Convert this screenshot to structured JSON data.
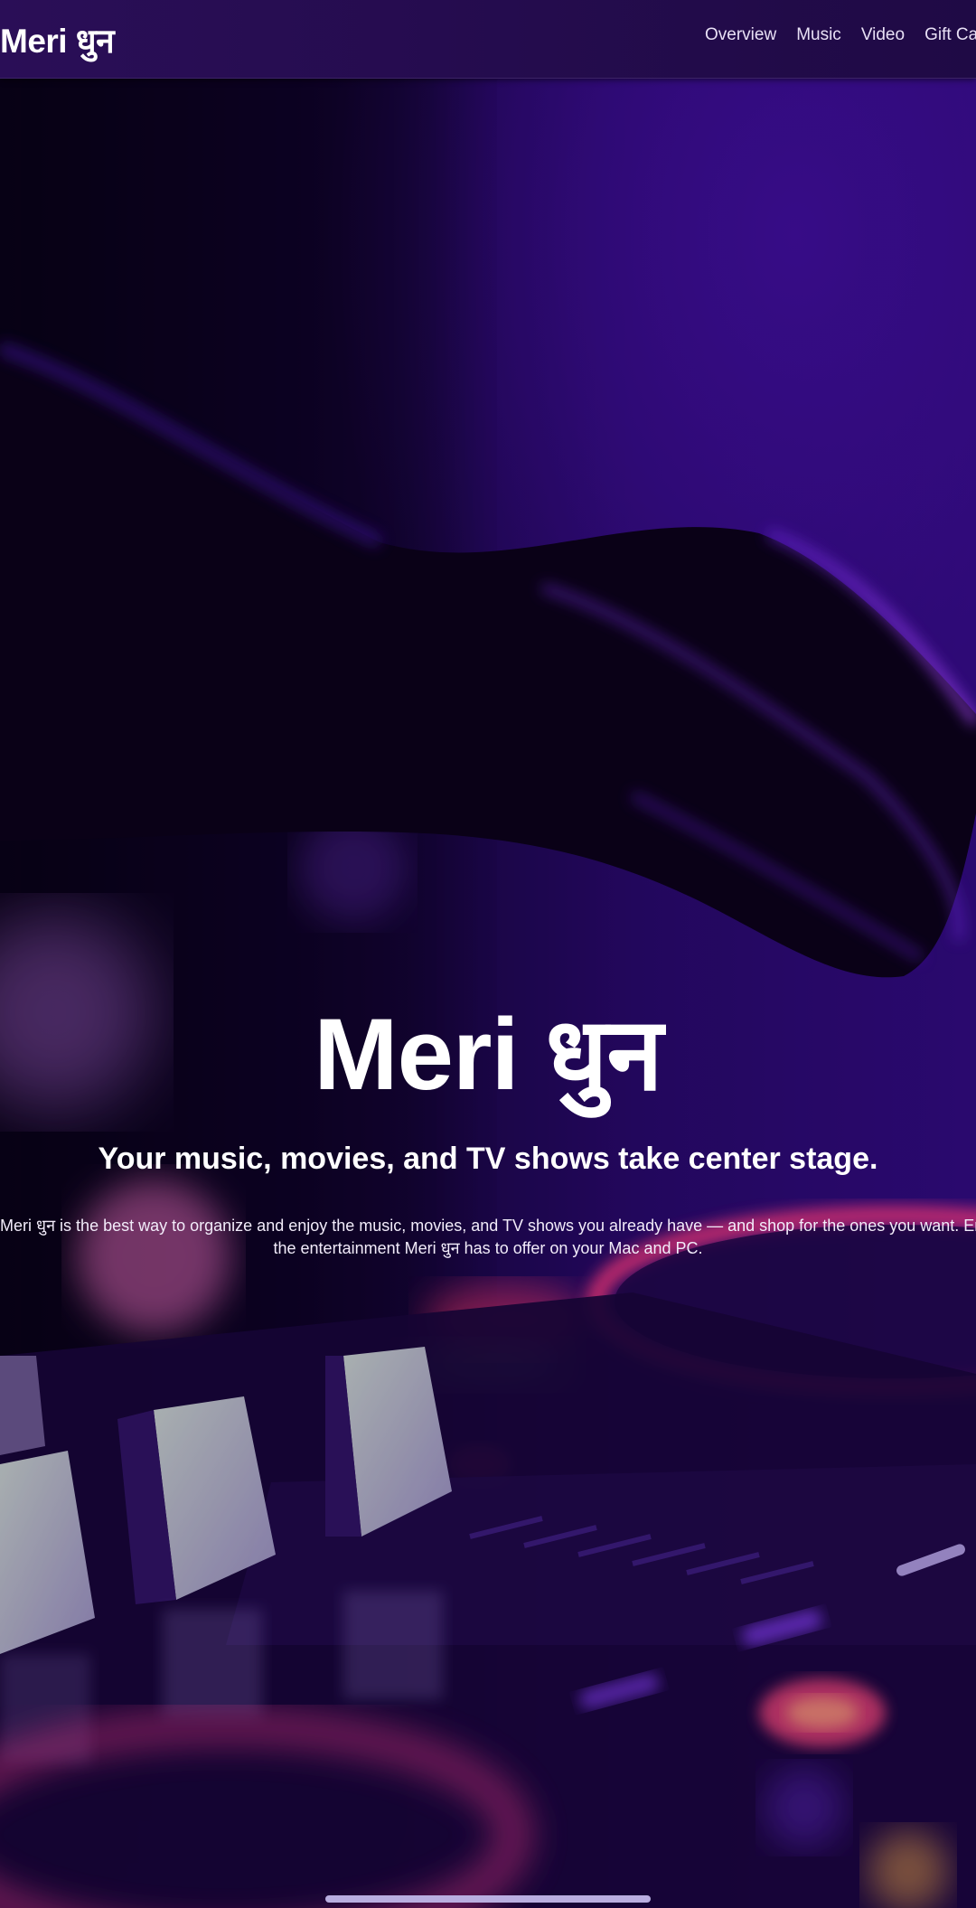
{
  "header": {
    "brand": "Meri धुन",
    "nav": [
      "Overview",
      "Music",
      "Video",
      "Gift Cards"
    ]
  },
  "hero": {
    "title": "Meri धुन",
    "tagline": "Your music, movies, and TV shows take center stage.",
    "description_line_1": "Meri धुन is the best way to organize and enjoy the music, movies, and TV shows you already have — and shop for the ones you want. Enjoy all",
    "description_line_2": "the entertainment Meri धुन has to offer on your Mac and PC.",
    "background_image": "dj-mixer-hand-photo"
  },
  "colors": {
    "header_bg": "#2a0e57",
    "accent_purple": "#3a0d8c",
    "text": "#ffffff"
  }
}
